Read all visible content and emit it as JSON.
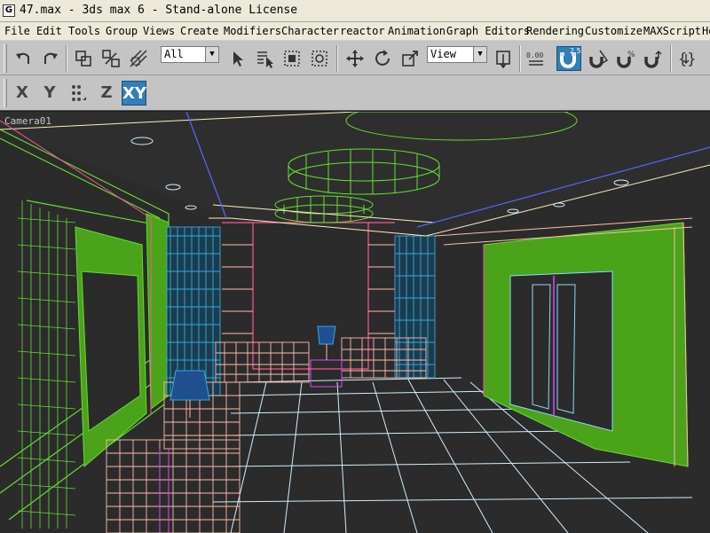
{
  "window": {
    "title": "47.max - 3ds max 6 - Stand-alone License",
    "icon": "app-logo-icon"
  },
  "menu": {
    "items": [
      "File",
      "Edit",
      "Tools",
      "Group",
      "Views",
      "Create",
      "Modifiers",
      "Character",
      "reactor",
      "Animation",
      "Graph Editors",
      "Rendering",
      "Customize",
      "MAXScript",
      "He"
    ]
  },
  "toolbar": {
    "selection_filter": "All",
    "reference_coord": "View",
    "snap_value": "2.5",
    "spinner_snap_label": "0.00",
    "icons": [
      "undo-icon",
      "redo-icon",
      "link-icon",
      "unlink-icon",
      "bind-space-warp-icon",
      "select-object-icon",
      "select-by-name-icon",
      "rect-selection-region-icon",
      "window-crossing-icon",
      "move-icon",
      "rotate-icon",
      "scale-icon",
      "pivot-center-icon",
      "manipulate-icon",
      "spinner-snap-icon",
      "snap-toggle-icon",
      "angle-snap-icon",
      "percent-snap-icon",
      "mirror-icon",
      "named-selection-icon"
    ]
  },
  "axis_toolbar": {
    "buttons": [
      "X",
      "Y",
      "Z",
      "XY"
    ],
    "active": "XY"
  },
  "viewport": {
    "label": "Camera01"
  },
  "colors": {
    "accent": "#2f7fb8",
    "wire_green": "#66dd33",
    "wire_cyan": "#33ccee",
    "wire_pink": "#ffbbaa",
    "floor_grid": "#cfefff"
  }
}
